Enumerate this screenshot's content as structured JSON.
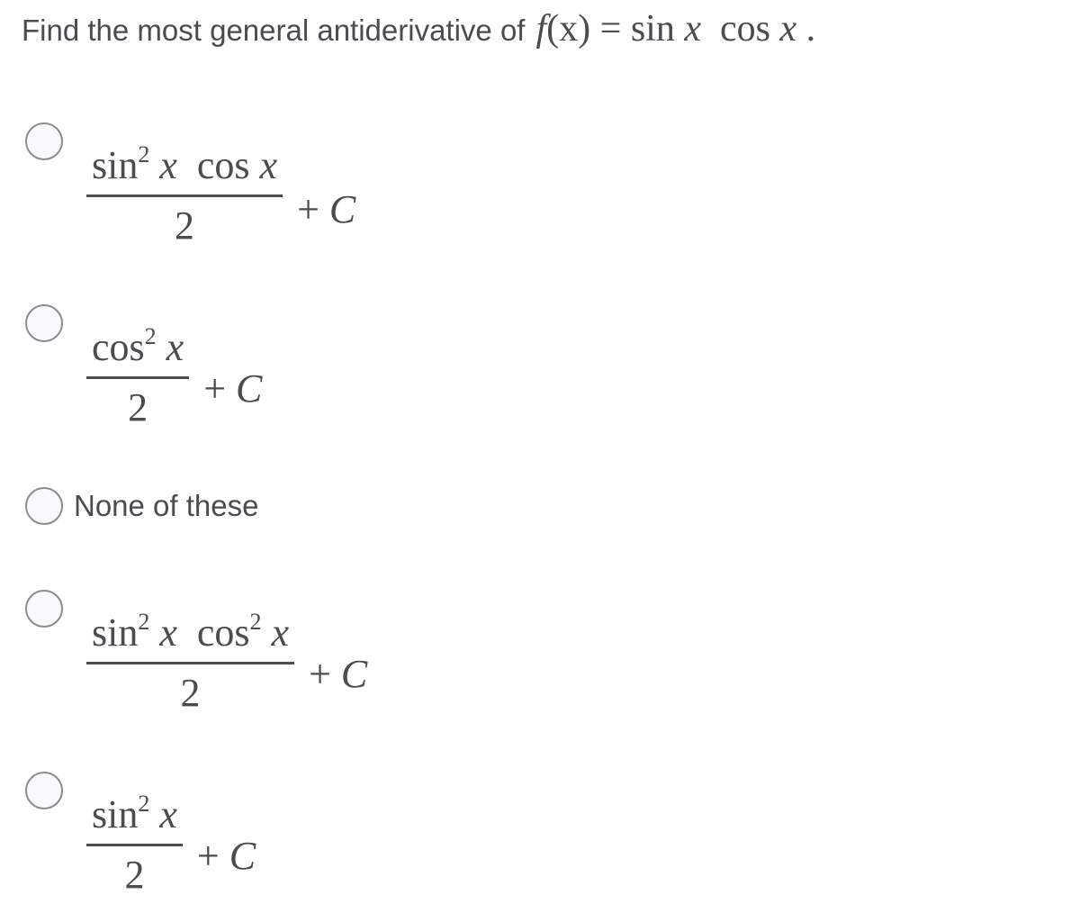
{
  "question": {
    "prefix": "Find the most general antiderivative of",
    "function_lhs_f": "f",
    "function_lhs_arg": "(x)",
    "equals": "=",
    "rhs_sin": "sin",
    "rhs_x1": "x",
    "rhs_cos": "cos",
    "rhs_x2": "x",
    "period": "."
  },
  "options": [
    {
      "type": "fraction",
      "numerator": "sin² x  cos x",
      "numerator_parts": {
        "a": "sin",
        "a_exp": "2",
        "a_var": "x",
        "b": "cos",
        "b_exp": "",
        "b_var": "x"
      },
      "denominator": "2",
      "suffix_plus": "+",
      "suffix_c": "C",
      "selected": false
    },
    {
      "type": "fraction",
      "numerator": "cos² x",
      "numerator_parts": {
        "a": "cos",
        "a_exp": "2",
        "a_var": "x"
      },
      "denominator": "2",
      "suffix_plus": "+",
      "suffix_c": "C",
      "selected": false
    },
    {
      "type": "text",
      "label": "None of these",
      "selected": false
    },
    {
      "type": "fraction",
      "numerator": "sin² x  cos² x",
      "numerator_parts": {
        "a": "sin",
        "a_exp": "2",
        "a_var": "x",
        "b": "cos",
        "b_exp": "2",
        "b_var": "x"
      },
      "denominator": "2",
      "suffix_plus": "+",
      "suffix_c": "C",
      "selected": false
    },
    {
      "type": "fraction",
      "numerator": "sin² x",
      "numerator_parts": {
        "a": "sin",
        "a_exp": "2",
        "a_var": "x"
      },
      "denominator": "2",
      "suffix_plus": "+",
      "suffix_c": "C",
      "selected": false
    }
  ]
}
